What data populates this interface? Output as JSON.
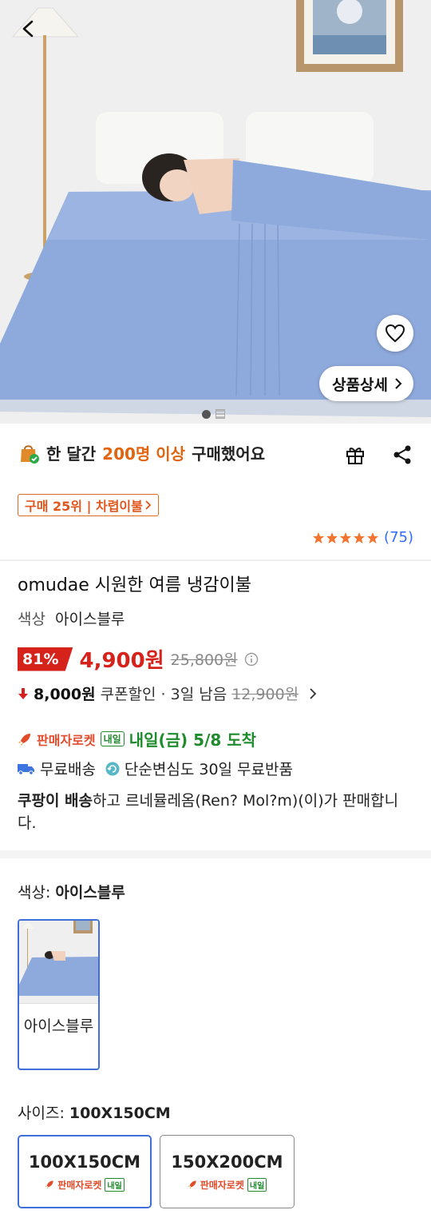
{
  "hero": {
    "detail_label": "상품상세"
  },
  "buy": {
    "prefix": "한 달간",
    "highlight": "200명 이상",
    "suffix": "구매했어요"
  },
  "rank_badge": "구매 25위 | 차렵이불",
  "rating": {
    "stars": 5,
    "count": "(75)"
  },
  "product": {
    "title": "omudae 시원한 여름 냉감이불",
    "color_label": "색상",
    "color_value": "아이스블루"
  },
  "price": {
    "discount": "81%",
    "sale": "4,900원",
    "original": "25,800원"
  },
  "coupon": {
    "amount": "8,000원",
    "text": "쿠폰할인 · 3일 남음",
    "original": "12,900원"
  },
  "shipping": {
    "rocket": "판매자로켓",
    "badge": "내일",
    "arrival": "내일(금) 5/8 도착",
    "free_delivery": "무료배송",
    "free_return": "단순변심도 30일 무료반품"
  },
  "seller": {
    "bold": "쿠팡이 배송",
    "text": "하고 르네뮬레옴(Ren? Mol?m)(이)가 판매합니다."
  },
  "options": {
    "color_heading": "색상:",
    "color_selected": "아이스블루",
    "color_items": [
      {
        "label": "아이스블루"
      }
    ],
    "size_heading": "사이즈:",
    "size_selected": "100X150CM",
    "sizes": [
      {
        "label": "100X150CM",
        "rocket": "판매자로켓",
        "badge": "내일"
      },
      {
        "label": "150X200CM",
        "rocket": "판매자로켓",
        "badge": "내일"
      }
    ]
  },
  "colors": {
    "accent_red": "#d5221b",
    "accent_orange": "#e2640f",
    "rocket_green": "#1f8b2d",
    "link_blue": "#346aff",
    "selected_border": "#3f6fd8"
  },
  "icons": [
    "back-icon",
    "heart-icon",
    "chevron-right-icon",
    "shopping-bag-icon",
    "gift-icon",
    "share-icon",
    "star-icon",
    "info-icon",
    "down-arrow-icon",
    "rocket-icon",
    "truck-icon",
    "return-icon"
  ]
}
